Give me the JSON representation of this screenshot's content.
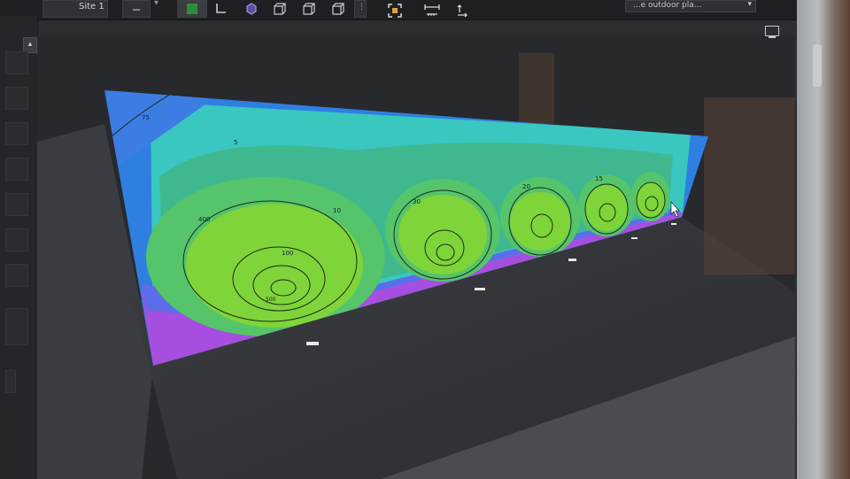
{
  "toolbar": {
    "site_tab_label": "Site 1",
    "dropdown_value": "...e outdoor pla...",
    "dropdown_arrow": "▾",
    "icons": [
      "undo-icon",
      "color-swatch-icon",
      "corner-icon",
      "cube-icon",
      "box-front-icon",
      "box-side-icon",
      "box-back-icon",
      "overflow-icon",
      "fit-view-icon",
      "measure-horizontal-icon",
      "measure-vertical-icon"
    ]
  },
  "left_panel": {
    "collapse_label": "▴"
  },
  "heatmap": {
    "contour_labels": [
      "75",
      "5",
      "400",
      "10",
      "100",
      "30",
      "500",
      "20",
      "15"
    ]
  }
}
